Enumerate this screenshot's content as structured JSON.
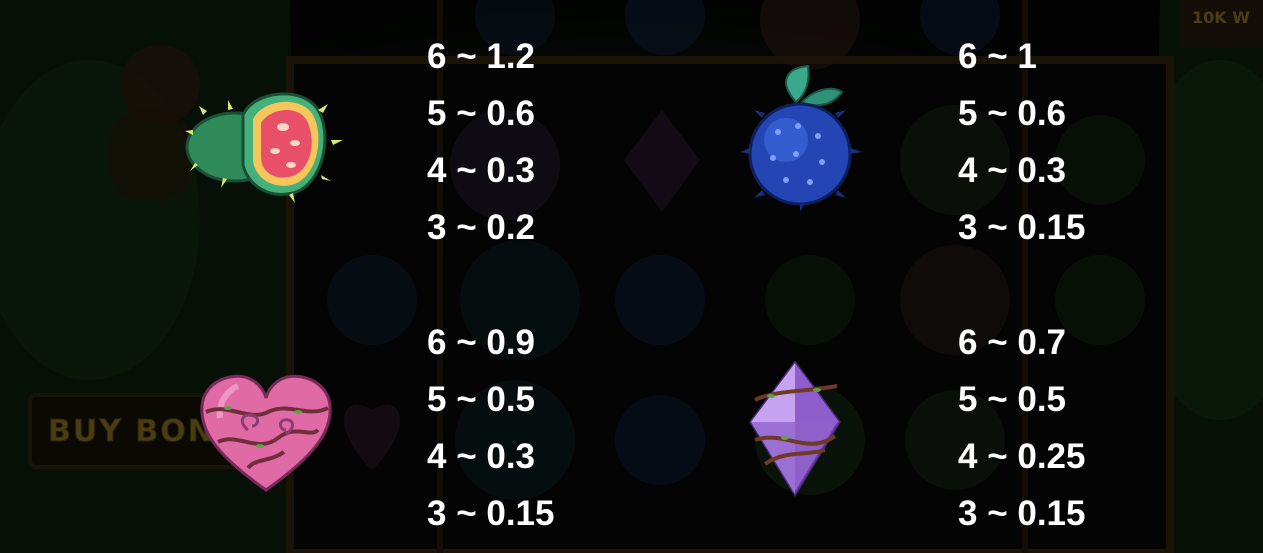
{
  "background": {
    "buy_bonus_label": "BUY BON",
    "corner_badge": "10K W"
  },
  "paytable": [
    {
      "symbol": "kiwano-fruit-icon",
      "lines": [
        "6 ~ 1.2",
        "5 ~ 0.6",
        "4 ~ 0.3",
        "3 ~ 0.2"
      ]
    },
    {
      "symbol": "blue-spiky-fruit-icon",
      "lines": [
        "6 ~ 1",
        "5 ~ 0.6",
        "4 ~ 0.3",
        "3 ~ 0.15"
      ]
    },
    {
      "symbol": "pink-heart-icon",
      "lines": [
        "6 ~ 0.9",
        "5 ~ 0.5",
        "4 ~ 0.3",
        "3 ~ 0.15"
      ]
    },
    {
      "symbol": "purple-diamond-icon",
      "lines": [
        "6 ~ 0.7",
        "5 ~ 0.5",
        "4 ~ 0.25",
        "3 ~ 0.15"
      ]
    }
  ],
  "colors": {
    "text": "#ffffff",
    "heart": "#e26aa8",
    "diamond": "#a77ed6",
    "blue_fruit": "#2a4ec0",
    "kiwano": "#3aa36e"
  }
}
